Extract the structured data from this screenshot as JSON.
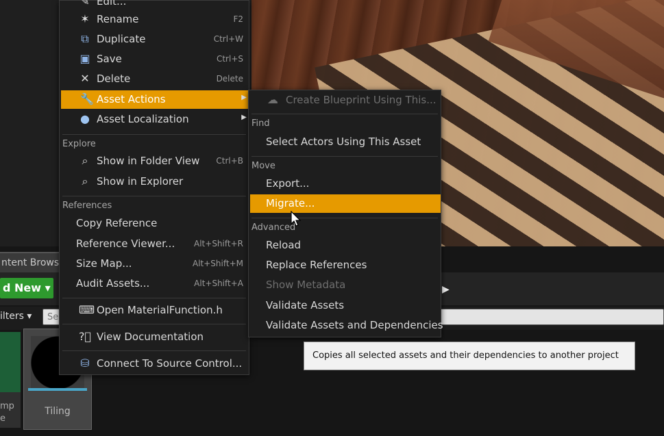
{
  "viewport": {},
  "content_browser": {
    "tab_label": "ntent Browse",
    "add_new_label": "d New ▾",
    "filters_label": "ilters ▾",
    "search_placeholder": "Se",
    "assets": [
      {
        "caption": "mp\ne"
      },
      {
        "label": "Tiling"
      }
    ]
  },
  "main_menu": {
    "items": [
      {
        "label": "Edit...",
        "shortcut": "",
        "icon": "edit-icon"
      },
      {
        "label": "Rename",
        "shortcut": "F2",
        "icon": "rename-icon"
      },
      {
        "label": "Duplicate",
        "shortcut": "Ctrl+W",
        "icon": "duplicate-icon"
      },
      {
        "label": "Save",
        "shortcut": "Ctrl+S",
        "icon": "save-icon"
      },
      {
        "label": "Delete",
        "shortcut": "Delete",
        "icon": "delete-icon"
      },
      {
        "label": "Asset Actions",
        "shortcut": "",
        "icon": "wrench-icon"
      },
      {
        "label": "Asset Localization",
        "shortcut": "",
        "icon": "globe-icon"
      }
    ],
    "explore": {
      "header": "Explore",
      "items": [
        {
          "label": "Show in Folder View",
          "shortcut": "Ctrl+B"
        },
        {
          "label": "Show in Explorer",
          "shortcut": ""
        }
      ]
    },
    "references": {
      "header": "References",
      "items": [
        {
          "label": "Copy Reference",
          "shortcut": ""
        },
        {
          "label": "Reference Viewer...",
          "shortcut": "Alt+Shift+R"
        },
        {
          "label": "Size Map...",
          "shortcut": "Alt+Shift+M"
        },
        {
          "label": "Audit Assets...",
          "shortcut": "Alt+Shift+A"
        }
      ]
    },
    "open_source": {
      "label": "Open MaterialFunction.h"
    },
    "view_docs": {
      "label": "View Documentation"
    },
    "source_control": {
      "label": "Connect To Source Control..."
    }
  },
  "sub_menu": {
    "create_blueprint": "Create Blueprint Using This...",
    "find": {
      "header": "Find",
      "items": [
        "Select Actors Using This Asset"
      ]
    },
    "move": {
      "header": "Move",
      "items": [
        "Export...",
        "Migrate..."
      ]
    },
    "advanced": {
      "header": "Advanced",
      "items": [
        "Reload",
        "Replace References",
        "Show Metadata",
        "Validate Assets",
        "Validate Assets and Dependencies"
      ]
    }
  },
  "tooltip": {
    "text": "Copies all selected assets and their dependencies to another project"
  },
  "colors": {
    "highlight": "#e69a00",
    "add_new_green": "#2e9a2e"
  }
}
